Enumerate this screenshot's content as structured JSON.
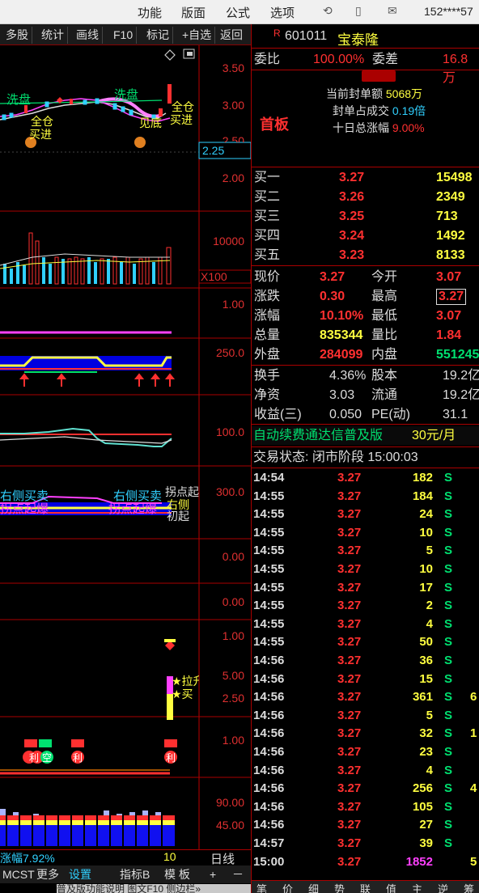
{
  "topbar": {
    "menu": [
      "功能",
      "版面",
      "公式",
      "选项"
    ],
    "phone": "152****57"
  },
  "toolbar": [
    "多股",
    "统计",
    "画线",
    "F10",
    "标记",
    "+自选",
    "返回"
  ],
  "chart": {
    "axis_labels": [
      "3.50",
      "3.00",
      "2.50",
      "2.25",
      "2.00",
      "10000",
      "X100",
      "1.00",
      "250.0",
      "100.0",
      "300.0",
      "0.00",
      "0.00",
      "1.00",
      "5.00",
      "2.50",
      "1.00",
      "90.00",
      "45.00"
    ],
    "annotations": {
      "wash1": "洗盘",
      "wash2": "洗盘",
      "full_buy_left_a": "全仓",
      "full_buy_left_b": "买进",
      "full_buy_right_a": "全仓",
      "full_buy_right_b": "买进",
      "see_bottom": "见底",
      "right_side_1": "右侧买卖",
      "right_side_2": "右侧买卖",
      "turn_up_1": "拐点起爆",
      "turn_up_2": "拐点起爆",
      "turn_right_a": "拐点起",
      "turn_right_b": "右侧",
      "turn_right_c": "初起",
      "lift_a": "★拉升",
      "lift_b": "★买",
      "sub_a": "利",
      "sub_b": "空",
      "sub_c": "利",
      "sub_d": "利"
    },
    "bottom_label": "涨幅7.92%",
    "bottom_count": "10",
    "bottom_period": "日线"
  },
  "tabs": [
    "MCST",
    "更多",
    "设置",
    "指标B",
    "模 板",
    "+",
    "－"
  ],
  "banner": "普及版功能说明 图文F10 侧边栏»",
  "stock": {
    "badge": "R",
    "code": "601011",
    "name": "宝泰隆"
  },
  "quote": {
    "weibi_label": "委比",
    "weibi_value": "100.00%",
    "weicha_label": "委差",
    "weicha_value": "16.8万",
    "limit_tag": "首板",
    "seal_amount_label": "当前封单额",
    "seal_amount_value": "5068万",
    "seal_ratio_label": "封单占成交",
    "seal_ratio_value": "0.19倍",
    "ten_day_label": "十日总涨幅",
    "ten_day_value": "9.00%",
    "bids": [
      {
        "label": "买一",
        "price": "3.27",
        "vol": "15498"
      },
      {
        "label": "买二",
        "price": "3.26",
        "vol": "2349"
      },
      {
        "label": "买三",
        "price": "3.25",
        "vol": "713"
      },
      {
        "label": "买四",
        "price": "3.24",
        "vol": "1492"
      },
      {
        "label": "买五",
        "price": "3.23",
        "vol": "8133"
      }
    ],
    "stats": [
      {
        "l1": "现价",
        "v1": "3.27",
        "l2": "今开",
        "v2": "3.07"
      },
      {
        "l1": "涨跌",
        "v1": "0.30",
        "l2": "最高",
        "v2": "3.27"
      },
      {
        "l1": "涨幅",
        "v1": "10.10%",
        "l2": "最低",
        "v2": "3.07"
      },
      {
        "l1": "总量",
        "v1": "835344",
        "l2": "量比",
        "v2": "1.84"
      },
      {
        "l1": "外盘",
        "v1": "284099",
        "l2": "内盘",
        "v2": "551245"
      }
    ],
    "fundamentals": [
      {
        "l1": "换手",
        "v1": "4.36%",
        "l2": "股本",
        "v2": "19.2亿"
      },
      {
        "l1": "净资",
        "v1": "3.03",
        "l2": "流通",
        "v2": "19.2亿"
      },
      {
        "l1": "收益(三)",
        "v1": "0.050",
        "l2": "PE(动)",
        "v2": "31.1"
      }
    ],
    "promo": "自动续费通达信普及版",
    "promo_price": "30元/月",
    "status": "交易状态: 闭市阶段 15:00:03"
  },
  "ticks": [
    {
      "t": "14:54",
      "p": "3.27",
      "v": "182",
      "s": "S",
      "x": ""
    },
    {
      "t": "14:55",
      "p": "3.27",
      "v": "184",
      "s": "S",
      "x": ""
    },
    {
      "t": "14:55",
      "p": "3.27",
      "v": "24",
      "s": "S",
      "x": ""
    },
    {
      "t": "14:55",
      "p": "3.27",
      "v": "10",
      "s": "S",
      "x": ""
    },
    {
      "t": "14:55",
      "p": "3.27",
      "v": "5",
      "s": "S",
      "x": ""
    },
    {
      "t": "14:55",
      "p": "3.27",
      "v": "10",
      "s": "S",
      "x": ""
    },
    {
      "t": "14:55",
      "p": "3.27",
      "v": "17",
      "s": "S",
      "x": ""
    },
    {
      "t": "14:55",
      "p": "3.27",
      "v": "2",
      "s": "S",
      "x": ""
    },
    {
      "t": "14:55",
      "p": "3.27",
      "v": "4",
      "s": "S",
      "x": ""
    },
    {
      "t": "14:55",
      "p": "3.27",
      "v": "50",
      "s": "S",
      "x": ""
    },
    {
      "t": "14:56",
      "p": "3.27",
      "v": "36",
      "s": "S",
      "x": ""
    },
    {
      "t": "14:56",
      "p": "3.27",
      "v": "15",
      "s": "S",
      "x": ""
    },
    {
      "t": "14:56",
      "p": "3.27",
      "v": "361",
      "s": "S",
      "x": "6"
    },
    {
      "t": "14:56",
      "p": "3.27",
      "v": "5",
      "s": "S",
      "x": ""
    },
    {
      "t": "14:56",
      "p": "3.27",
      "v": "32",
      "s": "S",
      "x": "1"
    },
    {
      "t": "14:56",
      "p": "3.27",
      "v": "23",
      "s": "S",
      "x": ""
    },
    {
      "t": "14:56",
      "p": "3.27",
      "v": "4",
      "s": "S",
      "x": ""
    },
    {
      "t": "14:56",
      "p": "3.27",
      "v": "256",
      "s": "S",
      "x": "4"
    },
    {
      "t": "14:56",
      "p": "3.27",
      "v": "105",
      "s": "S",
      "x": ""
    },
    {
      "t": "14:56",
      "p": "3.27",
      "v": "27",
      "s": "S",
      "x": ""
    },
    {
      "t": "14:57",
      "p": "3.27",
      "v": "39",
      "s": "S",
      "x": ""
    },
    {
      "t": "15:00",
      "p": "3.27",
      "v": "1852",
      "s": "",
      "x": "5"
    }
  ],
  "right_tabs": [
    "笔",
    "价",
    "细",
    "势",
    "联",
    "值",
    "主",
    "逆",
    "筹"
  ]
}
